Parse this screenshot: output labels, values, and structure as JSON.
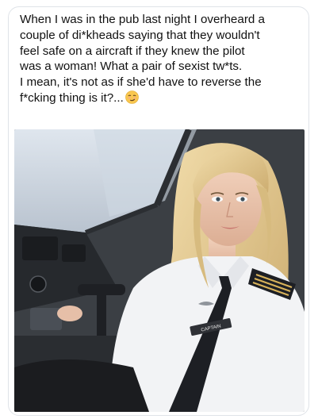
{
  "post": {
    "lines": [
      "When I was in the pub last night I overheard a",
      "couple of di*kheads saying that they wouldn't",
      "feel safe on a aircraft if they knew the pilot",
      "was a woman! What a pair of sexist tw*ts.",
      "I mean, it's not as if she'd have to reverse the",
      "f*cking thing is it?..."
    ],
    "emoji": "smirking-face",
    "image": {
      "name_tag": "CAPTAIN",
      "colors": {
        "cockpit": "#3b3f44",
        "shirt": "#f2f3f5",
        "tie": "#1d1f24",
        "hair": "#e6cc95",
        "epaulette_stripe": "#d8b25a"
      }
    }
  }
}
